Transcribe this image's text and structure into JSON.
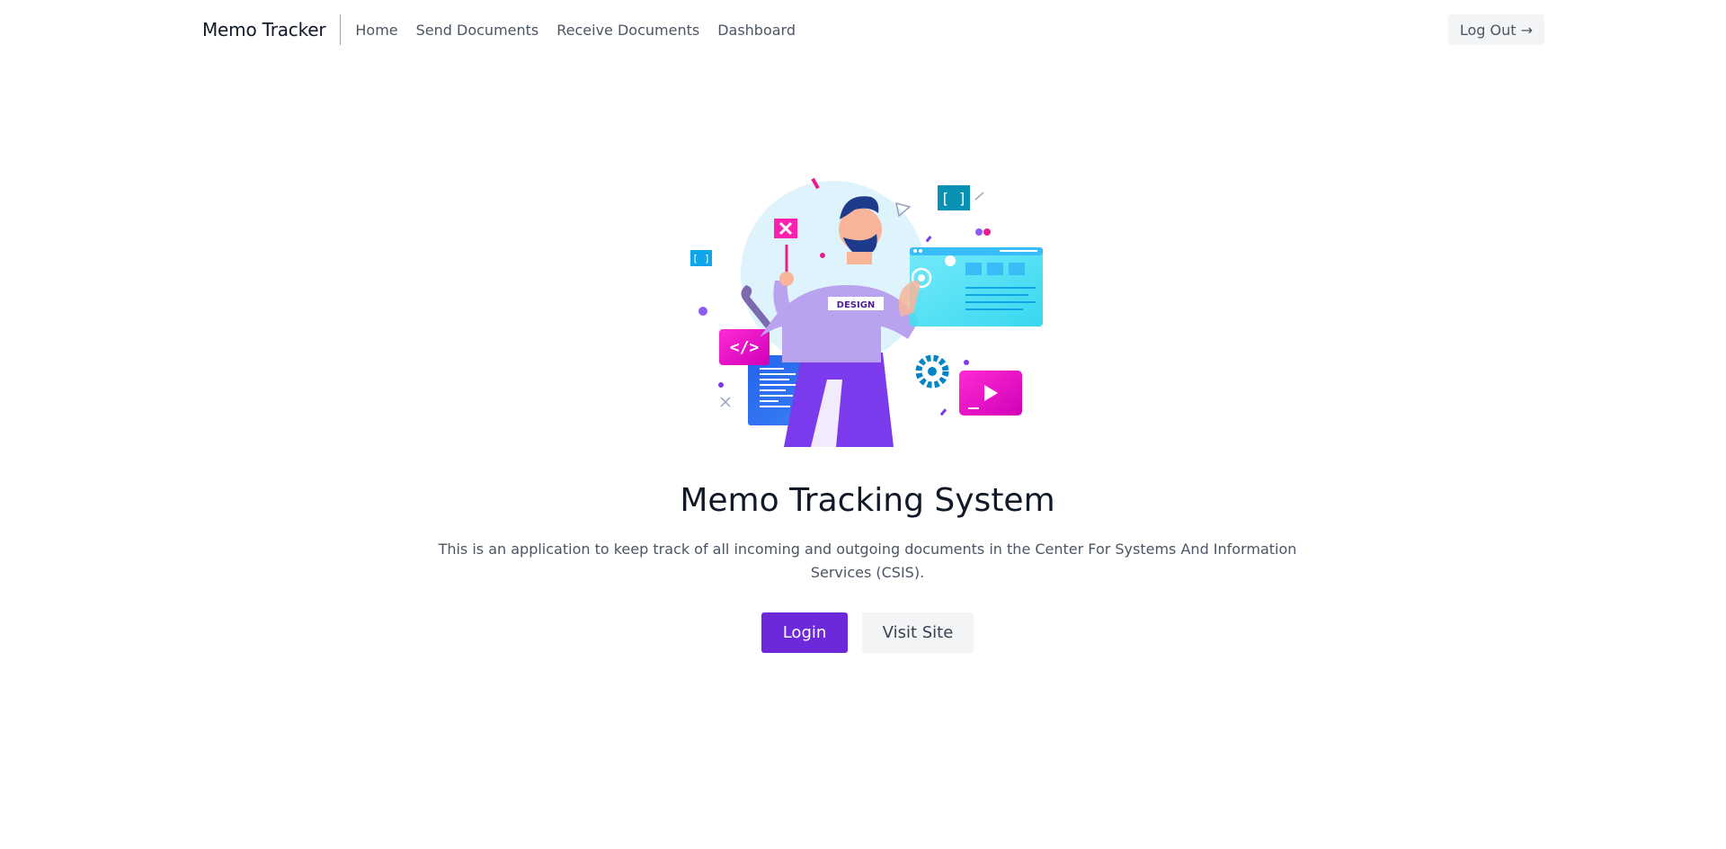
{
  "nav": {
    "brand": "Memo Tracker",
    "links": [
      {
        "label": "Home"
      },
      {
        "label": "Send Documents"
      },
      {
        "label": "Receive Documents"
      },
      {
        "label": "Dashboard"
      }
    ],
    "logout_label": "Log Out →"
  },
  "hero": {
    "illustration_shirt_text": "DESIGN",
    "illustration_icon": "</>",
    "title": "Memo Tracking System",
    "description": "This is an application to keep track of all incoming and outgoing documents in the Center For Systems And Information Services (CSIS).",
    "login_label": "Login",
    "visit_label": "Visit Site"
  },
  "colors": {
    "accent": "#6d28d9",
    "nav_text": "#4b5563",
    "secondary_button_bg": "#f3f4f6"
  }
}
